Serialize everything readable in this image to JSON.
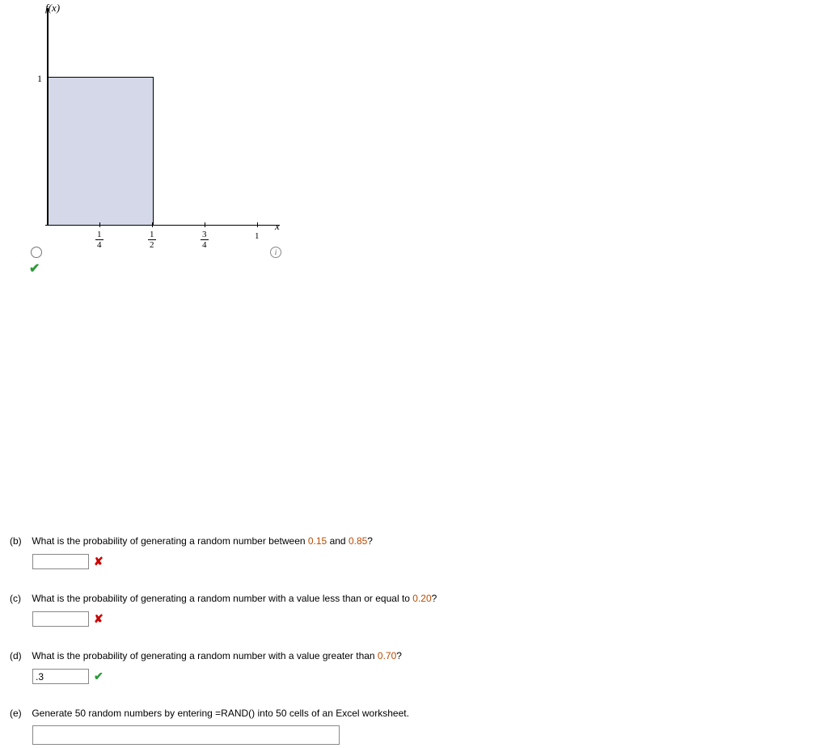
{
  "chart_data": {
    "type": "area",
    "title": "",
    "xlabel": "x",
    "ylabel": "f(x)",
    "xlim": [
      0,
      1
    ],
    "ylim": [
      0,
      1
    ],
    "x_ticks": [
      "1/4",
      "1/2",
      "3/4",
      "1"
    ],
    "y_ticks": [
      "1"
    ],
    "series": [
      {
        "name": "f(x)",
        "x": [
          0,
          0.5
        ],
        "y": [
          1,
          1
        ]
      }
    ],
    "annotations": [
      "shaded rectangle from x=0 to x=0.5, height=1"
    ]
  },
  "graph": {
    "y_label": "f(x)",
    "x_label": "x",
    "y_tick_1": "1",
    "x_ticks": {
      "t1_top": "1",
      "t1_bot": "4",
      "t2_top": "1",
      "t2_bot": "2",
      "t3_top": "3",
      "t3_bot": "4",
      "t4": "1"
    },
    "info": "i"
  },
  "questions": {
    "b": {
      "label": "(b)",
      "prefix": "What is the probability of generating a random number between ",
      "v1": "0.15",
      "mid": " and ",
      "v2": "0.85",
      "suffix": "?",
      "value": ""
    },
    "c": {
      "label": "(c)",
      "prefix": "What is the probability of generating a random number with a value less than or equal to ",
      "v1": "0.20",
      "suffix": "?",
      "value": ""
    },
    "d": {
      "label": "(d)",
      "prefix": "What is the probability of generating a random number with a value greater than ",
      "v1": "0.70",
      "suffix": "?",
      "value": ".3"
    },
    "e": {
      "label": "(e)",
      "text": "Generate 50 random numbers by entering =RAND() into 50 cells of an Excel worksheet."
    }
  }
}
